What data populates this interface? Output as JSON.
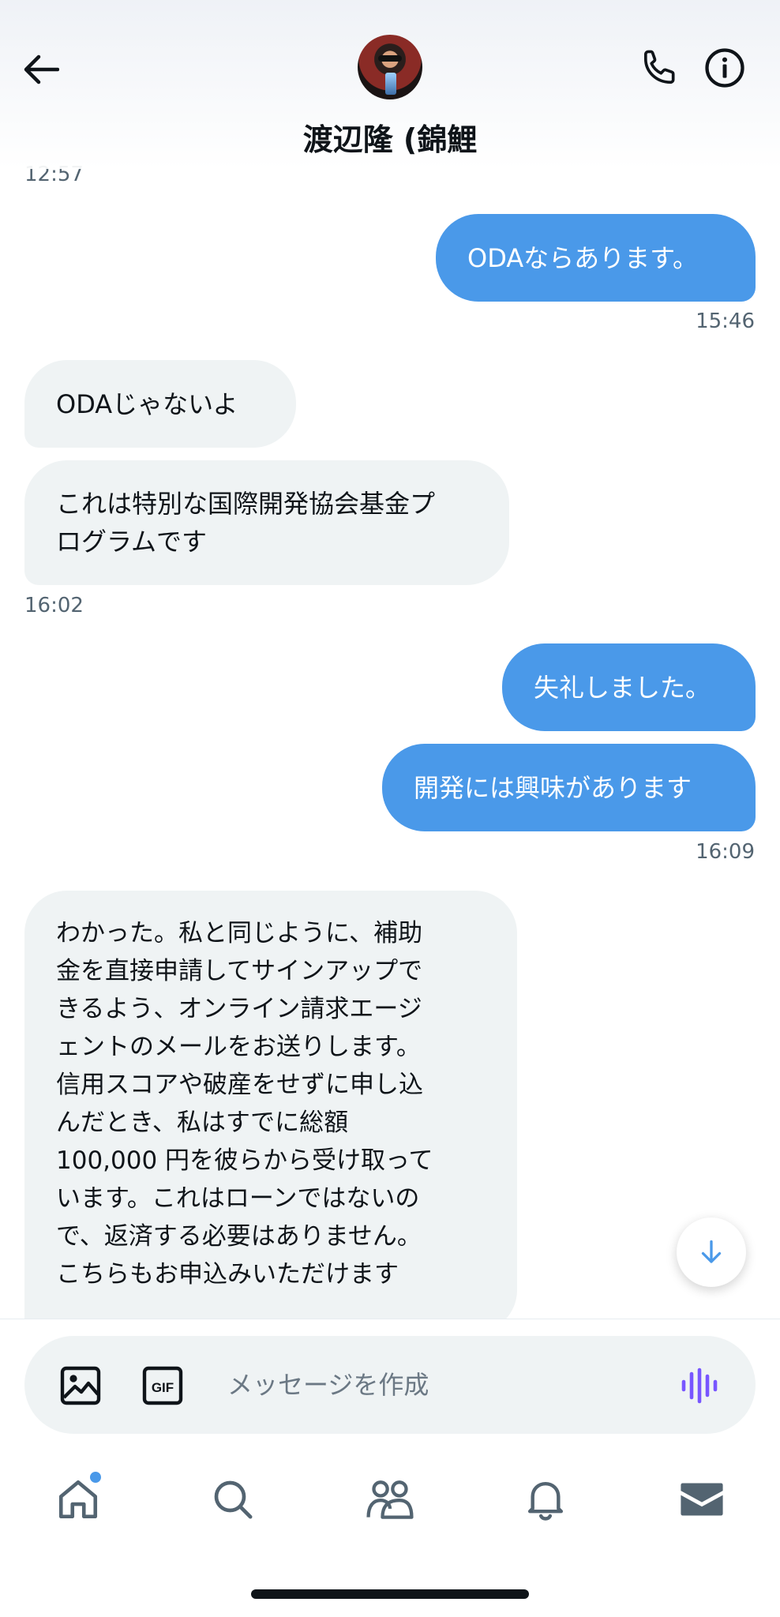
{
  "header": {
    "contact_name": "渡辺隆 (錦鯉"
  },
  "messages": [
    {
      "kind": "timestamp",
      "side": "left",
      "text": "12:57"
    },
    {
      "kind": "bubble",
      "side": "out",
      "text": "ODAならあります。"
    },
    {
      "kind": "timestamp",
      "side": "right",
      "text": "15:46"
    },
    {
      "kind": "bubble",
      "side": "in",
      "text": "ODAじゃないよ"
    },
    {
      "kind": "bubble",
      "side": "in",
      "text": "これは特別な国際開発協会基金プ\nログラムです"
    },
    {
      "kind": "timestamp",
      "side": "left",
      "text": "16:02"
    },
    {
      "kind": "bubble",
      "side": "out",
      "text": "失礼しました。"
    },
    {
      "kind": "bubble",
      "side": "out",
      "text": "開発には興味があります"
    },
    {
      "kind": "timestamp",
      "side": "right",
      "text": "16:09"
    },
    {
      "kind": "bubble",
      "side": "in",
      "text": "わかった。私と同じように、補助\n金を直接申請してサインアップで\nきるよう、オンライン請求エージ\nェントのメールをお送りします。\n信用スコアや破産をせずに申し込\nんだとき、私はすでに総額\n100,000 円を彼らから受け取って\nいます。これはローンではないの\nで、返済する必要はありません。\nこちらもお申込みいただけます"
    }
  ],
  "composer": {
    "placeholder": "メッセージを作成",
    "gif_label": "GIF"
  },
  "nav": {
    "items": [
      {
        "icon": "home-icon",
        "has_notification_dot": true
      },
      {
        "icon": "search-icon"
      },
      {
        "icon": "communities-icon"
      },
      {
        "icon": "notifications-icon"
      },
      {
        "icon": "messages-icon",
        "active": true
      }
    ]
  },
  "colors": {
    "accent": "#4a99e9",
    "incoming_bubble": "#eff3f4",
    "voice_icon": "#7856ff",
    "timestamp": "#536471"
  }
}
